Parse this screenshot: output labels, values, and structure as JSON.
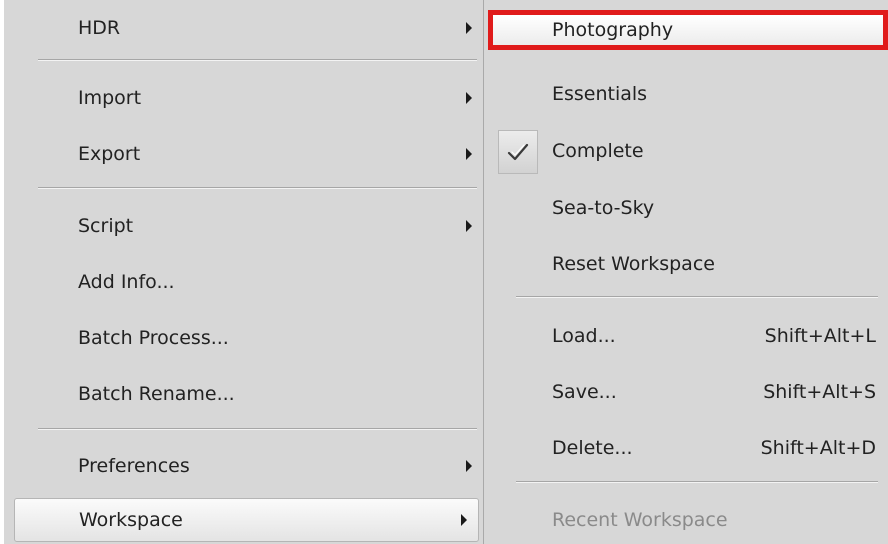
{
  "left_menu": {
    "items": [
      {
        "label": "HDR"
      },
      {
        "label": "Import"
      },
      {
        "label": "Export"
      },
      {
        "label": "Script"
      },
      {
        "label": "Add Info..."
      },
      {
        "label": "Batch Process..."
      },
      {
        "label": "Batch Rename..."
      },
      {
        "label": "Preferences"
      },
      {
        "label": "Workspace"
      }
    ]
  },
  "right_menu": {
    "items": [
      {
        "label": "Photography"
      },
      {
        "label": "Essentials"
      },
      {
        "label": "Complete"
      },
      {
        "label": "Sea-to-Sky"
      },
      {
        "label": "Reset Workspace"
      },
      {
        "label": "Load...",
        "shortcut": "Shift+Alt+L"
      },
      {
        "label": "Save...",
        "shortcut": "Shift+Alt+S"
      },
      {
        "label": "Delete...",
        "shortcut": "Shift+Alt+D"
      },
      {
        "label": "Recent Workspace"
      }
    ]
  },
  "colors": {
    "menu_bg": "#d7d7d7",
    "highlight_border": "#e01b1b",
    "disabled_text": "#8a8a8a"
  },
  "icons": {
    "active_workspace": "check-icon",
    "submenu": "submenu-arrow-icon"
  }
}
